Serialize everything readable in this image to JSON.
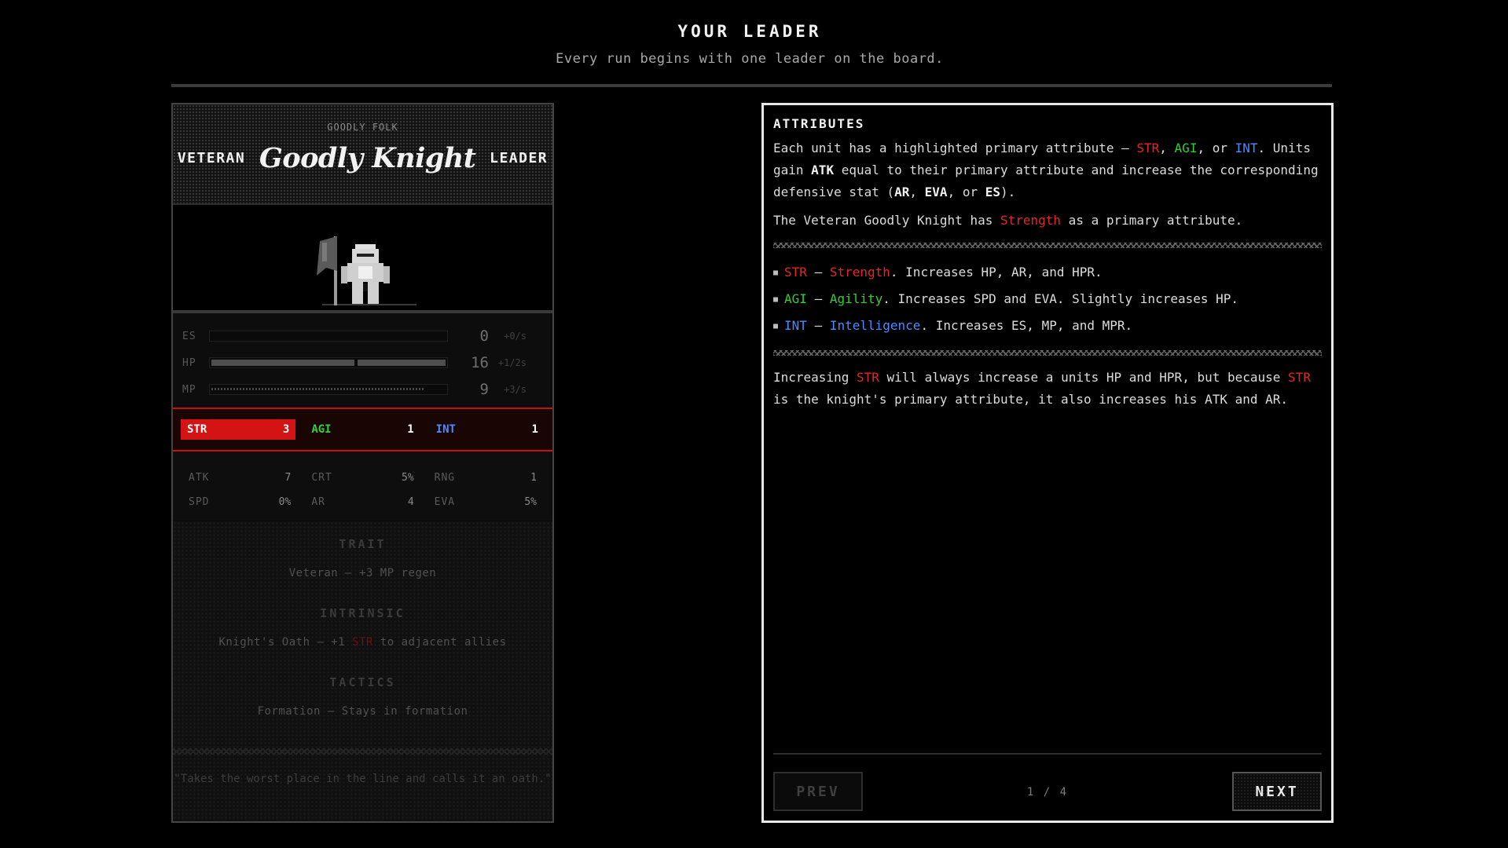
{
  "header": {
    "title": "YOUR LEADER",
    "subtitle": "Every run begins with one leader on the board."
  },
  "card": {
    "faction": "GOODLY FOLK",
    "name_prefix": "VETERAN",
    "name_main": "Goodly Knight",
    "name_suffix": "LEADER",
    "bars": [
      {
        "label": "ES",
        "value": "0",
        "regen": "+0/s",
        "fill": 0
      },
      {
        "label": "HP",
        "value": "16",
        "regen": "+1/2s",
        "fill": 1.0
      },
      {
        "label": "MP",
        "value": "9",
        "regen": "+3/s",
        "fill": 0.9
      }
    ],
    "attributes": {
      "str": {
        "label": "STR",
        "value": "3"
      },
      "agi": {
        "label": "AGI",
        "value": "1"
      },
      "int": {
        "label": "INT",
        "value": "1"
      }
    },
    "stats": {
      "atk": {
        "label": "ATK",
        "value": "7"
      },
      "crt": {
        "label": "CRT",
        "value": "5%"
      },
      "rng": {
        "label": "RNG",
        "value": "1"
      },
      "spd": {
        "label": "SPD",
        "value": "0%"
      },
      "ar": {
        "label": "AR",
        "value": "4"
      },
      "eva": {
        "label": "EVA",
        "value": "5%"
      }
    },
    "trait": {
      "title": "TRAIT",
      "text": "Veteran — +3 MP regen"
    },
    "intrinsic": {
      "title": "INTRINSIC",
      "text_pre": "Knight's Oath — +1 ",
      "text_red": "STR",
      "text_post": " to adjacent allies"
    },
    "tactics": {
      "title": "TACTICS",
      "text": "Formation — Stays in formation"
    },
    "quote": "\"Takes the worst place in the line and calls it an oath.\""
  },
  "panel": {
    "title": "ATTRIBUTES",
    "p1": {
      "a": "Each unit has a highlighted primary attribute — ",
      "str": "STR",
      "b": ", ",
      "agi": "AGI",
      "c": ", or ",
      "int": "INT",
      "d": ". Units gain ",
      "e": "ATK",
      "f": " equal to their primary attribute and increase the corresponding defensive stat (",
      "g": "AR",
      "h": ", ",
      "i": "EVA",
      "j": ", or ",
      "k": "ES",
      "l": ")."
    },
    "p2": {
      "a": "The Veteran Goodly Knight has ",
      "b": "Strength",
      "c": " as a primary attribute."
    },
    "list": [
      {
        "abbr": "STR",
        "dash": " — ",
        "name": "Strength",
        "text": ". Increases HP, AR, and HPR."
      },
      {
        "abbr": "AGI",
        "dash": " — ",
        "name": "Agility",
        "text": ". Increases SPD and EVA. Slightly increases HP."
      },
      {
        "abbr": "INT",
        "dash": " — ",
        "name": "Intelligence",
        "text": ". Increases ES, MP, and MPR."
      }
    ],
    "p3": {
      "a": "Increasing ",
      "b": "STR",
      "c": " will always increase a units HP and HPR, but because ",
      "d": "STR",
      "e": " is the knight's primary attribute, it also increases his ATK and AR."
    },
    "prev_label": "PREV",
    "next_label": "NEXT",
    "page": "1 / 4"
  },
  "colors": {
    "str": "#e82525",
    "agi": "#2fd12f",
    "int": "#4b8bff"
  }
}
